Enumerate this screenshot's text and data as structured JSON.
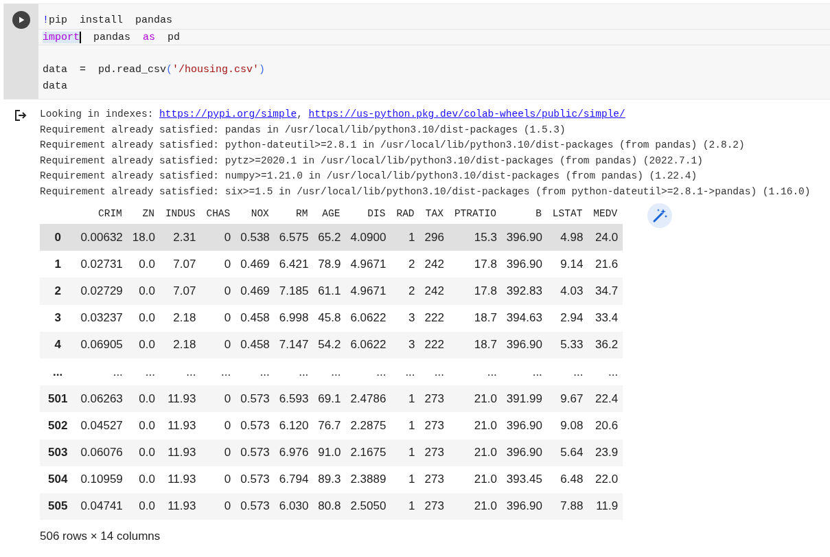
{
  "code_cell": {
    "lines": [
      {
        "kind": "code",
        "current": false,
        "tokens": [
          {
            "text": "!",
            "kind": "bang"
          },
          {
            "text": "pip  install  pandas",
            "kind": "plain"
          }
        ]
      },
      {
        "kind": "code",
        "current": true,
        "tokens": [
          {
            "text": "import",
            "kind": "keyword_selected"
          },
          {
            "text": "  pandas  ",
            "kind": "plain"
          },
          {
            "text": "as",
            "kind": "keyword"
          },
          {
            "text": "  pd",
            "kind": "plain"
          }
        ]
      },
      {
        "kind": "blank",
        "current": false
      },
      {
        "kind": "code",
        "current": false,
        "tokens": [
          {
            "text": "data  =  pd.read_csv",
            "kind": "plain"
          },
          {
            "text": "(",
            "kind": "paren"
          },
          {
            "text": "'/housing.csv'",
            "kind": "string"
          },
          {
            "text": ")",
            "kind": "paren"
          }
        ]
      },
      {
        "kind": "code",
        "current": false,
        "tokens": [
          {
            "text": "data",
            "kind": "plain"
          }
        ]
      }
    ]
  },
  "output": {
    "lines": [
      [
        {
          "text": "Looking in indexes: ",
          "kind": "text"
        },
        {
          "text": "https://pypi.org/simple",
          "kind": "link"
        },
        {
          "text": ", ",
          "kind": "text"
        },
        {
          "text": "https://us-python.pkg.dev/colab-wheels/public/simple/",
          "kind": "link"
        }
      ],
      [
        {
          "text": "Requirement already satisfied: pandas in /usr/local/lib/python3.10/dist-packages (1.5.3)",
          "kind": "text"
        }
      ],
      [
        {
          "text": "Requirement already satisfied: python-dateutil>=2.8.1 in /usr/local/lib/python3.10/dist-packages (from pandas) (2.8.2)",
          "kind": "text"
        }
      ],
      [
        {
          "text": "Requirement already satisfied: pytz>=2020.1 in /usr/local/lib/python3.10/dist-packages (from pandas) (2022.7.1)",
          "kind": "text"
        }
      ],
      [
        {
          "text": "Requirement already satisfied: numpy>=1.21.0 in /usr/local/lib/python3.10/dist-packages (from pandas) (1.22.4)",
          "kind": "text"
        }
      ],
      [
        {
          "text": "Requirement already satisfied: six>=1.5 in /usr/local/lib/python3.10/dist-packages (from python-dateutil>=2.8.1->pandas) (1.16.0)",
          "kind": "text"
        }
      ]
    ]
  },
  "table": {
    "columns": [
      "CRIM",
      "ZN",
      "INDUS",
      "CHAS",
      "NOX",
      "RM",
      "AGE",
      "DIS",
      "RAD",
      "TAX",
      "PTRATIO",
      "B",
      "LSTAT",
      "MEDV"
    ],
    "rows": [
      {
        "index": "0",
        "cells": [
          "0.00632",
          "18.0",
          "2.31",
          "0",
          "0.538",
          "6.575",
          "65.2",
          "4.0900",
          "1",
          "296",
          "15.3",
          "396.90",
          "4.98",
          "24.0"
        ],
        "highlighted": true
      },
      {
        "index": "1",
        "cells": [
          "0.02731",
          "0.0",
          "7.07",
          "0",
          "0.469",
          "6.421",
          "78.9",
          "4.9671",
          "2",
          "242",
          "17.8",
          "396.90",
          "9.14",
          "21.6"
        ],
        "highlighted": false
      },
      {
        "index": "2",
        "cells": [
          "0.02729",
          "0.0",
          "7.07",
          "0",
          "0.469",
          "7.185",
          "61.1",
          "4.9671",
          "2",
          "242",
          "17.8",
          "392.83",
          "4.03",
          "34.7"
        ],
        "highlighted": false
      },
      {
        "index": "3",
        "cells": [
          "0.03237",
          "0.0",
          "2.18",
          "0",
          "0.458",
          "6.998",
          "45.8",
          "6.0622",
          "3",
          "222",
          "18.7",
          "394.63",
          "2.94",
          "33.4"
        ],
        "highlighted": false
      },
      {
        "index": "4",
        "cells": [
          "0.06905",
          "0.0",
          "2.18",
          "0",
          "0.458",
          "7.147",
          "54.2",
          "6.0622",
          "3",
          "222",
          "18.7",
          "396.90",
          "5.33",
          "36.2"
        ],
        "highlighted": false
      },
      {
        "index": "...",
        "cells": [
          "...",
          "...",
          "...",
          "...",
          "...",
          "...",
          "...",
          "...",
          "...",
          "...",
          "...",
          "...",
          "...",
          "..."
        ],
        "highlighted": false
      },
      {
        "index": "501",
        "cells": [
          "0.06263",
          "0.0",
          "11.93",
          "0",
          "0.573",
          "6.593",
          "69.1",
          "2.4786",
          "1",
          "273",
          "21.0",
          "391.99",
          "9.67",
          "22.4"
        ],
        "highlighted": false
      },
      {
        "index": "502",
        "cells": [
          "0.04527",
          "0.0",
          "11.93",
          "0",
          "0.573",
          "6.120",
          "76.7",
          "2.2875",
          "1",
          "273",
          "21.0",
          "396.90",
          "9.08",
          "20.6"
        ],
        "highlighted": false
      },
      {
        "index": "503",
        "cells": [
          "0.06076",
          "0.0",
          "11.93",
          "0",
          "0.573",
          "6.976",
          "91.0",
          "2.1675",
          "1",
          "273",
          "21.0",
          "396.90",
          "5.64",
          "23.9"
        ],
        "highlighted": false
      },
      {
        "index": "504",
        "cells": [
          "0.10959",
          "0.0",
          "11.93",
          "0",
          "0.573",
          "6.794",
          "89.3",
          "2.3889",
          "1",
          "273",
          "21.0",
          "393.45",
          "6.48",
          "22.0"
        ],
        "highlighted": false
      },
      {
        "index": "505",
        "cells": [
          "0.04741",
          "0.0",
          "11.93",
          "0",
          "0.573",
          "6.030",
          "80.8",
          "2.5050",
          "1",
          "273",
          "21.0",
          "396.90",
          "7.88",
          "11.9"
        ],
        "highlighted": false
      }
    ],
    "summary": "506 rows × 14 columns"
  }
}
